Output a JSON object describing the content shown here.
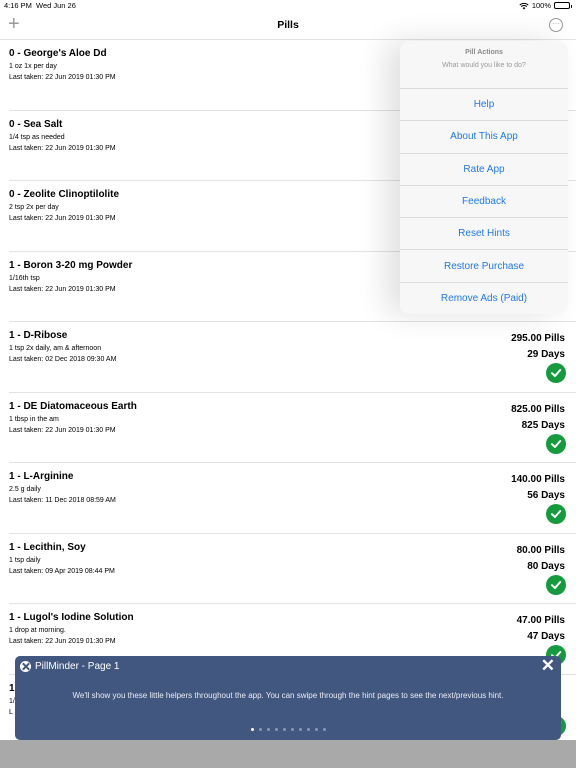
{
  "status_bar": {
    "time": "4:16 PM",
    "date": "Wed Jun 26",
    "battery": "100%"
  },
  "nav": {
    "add_label": "+",
    "title": "Pills",
    "more_label": "···"
  },
  "items": [
    {
      "name": "0 - George's Aloe Dd",
      "dose": "1 oz 1x per day",
      "last_taken": "Last taken: 22 Jun 2019 01:30 PM",
      "pills": "",
      "days": "",
      "check": false
    },
    {
      "name": "0 - Sea Salt",
      "dose": "1/4 tsp as needed",
      "last_taken": "Last taken: 22 Jun 2019 01:30 PM",
      "pills": "",
      "days": "",
      "check": false
    },
    {
      "name": "0 - Zeolite Clinoptilolite",
      "dose": "2 tsp 2x per day",
      "last_taken": "Last taken: 22 Jun 2019 01:30 PM",
      "pills": "",
      "days": "",
      "check": false
    },
    {
      "name": "1 - Boron 3-20 mg Powder",
      "dose": "1/16th tsp",
      "last_taken": "Last taken: 22 Jun 2019 01:30 PM",
      "pills": "",
      "days": "",
      "check": false
    },
    {
      "name": "1 - D-Ribose",
      "dose": "1 tsp 2x daily, am & afternoon",
      "last_taken": "Last taken: 02 Dec 2018 09:30 AM",
      "pills": "295.00 Pills",
      "days": "29 Days",
      "check": true
    },
    {
      "name": "1 - DE Diatomaceous Earth",
      "dose": "1 tbsp in the am",
      "last_taken": "Last taken: 22 Jun 2019 01:30 PM",
      "pills": "825.00 Pills",
      "days": "825 Days",
      "check": true
    },
    {
      "name": "1 - L-Arginine",
      "dose": "2.5 g daily",
      "last_taken": "Last taken: 11 Dec 2018 08:59 AM",
      "pills": "140.00 Pills",
      "days": "56 Days",
      "check": true
    },
    {
      "name": "1 - Lecithin, Soy",
      "dose": "1 tsp daily",
      "last_taken": "Last taken: 09 Apr 2019 08:44 PM",
      "pills": "80.00 Pills",
      "days": "80 Days",
      "check": true
    },
    {
      "name": "1 - Lugol's Iodine Solution",
      "dose": "1 drop at morning.",
      "last_taken": "Last taken: 22 Jun 2019 01:30 PM",
      "pills": "47.00 Pills",
      "days": "47 Days",
      "check": true
    },
    {
      "name": "1",
      "dose": "1/",
      "last_taken": "L",
      "pills": "",
      "days": "",
      "check": true
    }
  ],
  "popover": {
    "title": "Pill Actions",
    "subtitle": "What would you like to do?",
    "actions": [
      "Help",
      "About This App",
      "Rate App",
      "Feedback",
      "Reset Hints",
      "Restore Purchase",
      "Remove Ads (Paid)"
    ]
  },
  "hint": {
    "title": "PillMinder - Page 1",
    "close_label": "✕",
    "body": "We'll show you these little helpers throughout the app. You can swipe through the hint pages to see the next/previous hint.",
    "page_count": 10,
    "current_page": 1
  },
  "colors": {
    "accent": "#1e78f0",
    "check": "#159a3e",
    "hint_bg": "#42577f"
  }
}
